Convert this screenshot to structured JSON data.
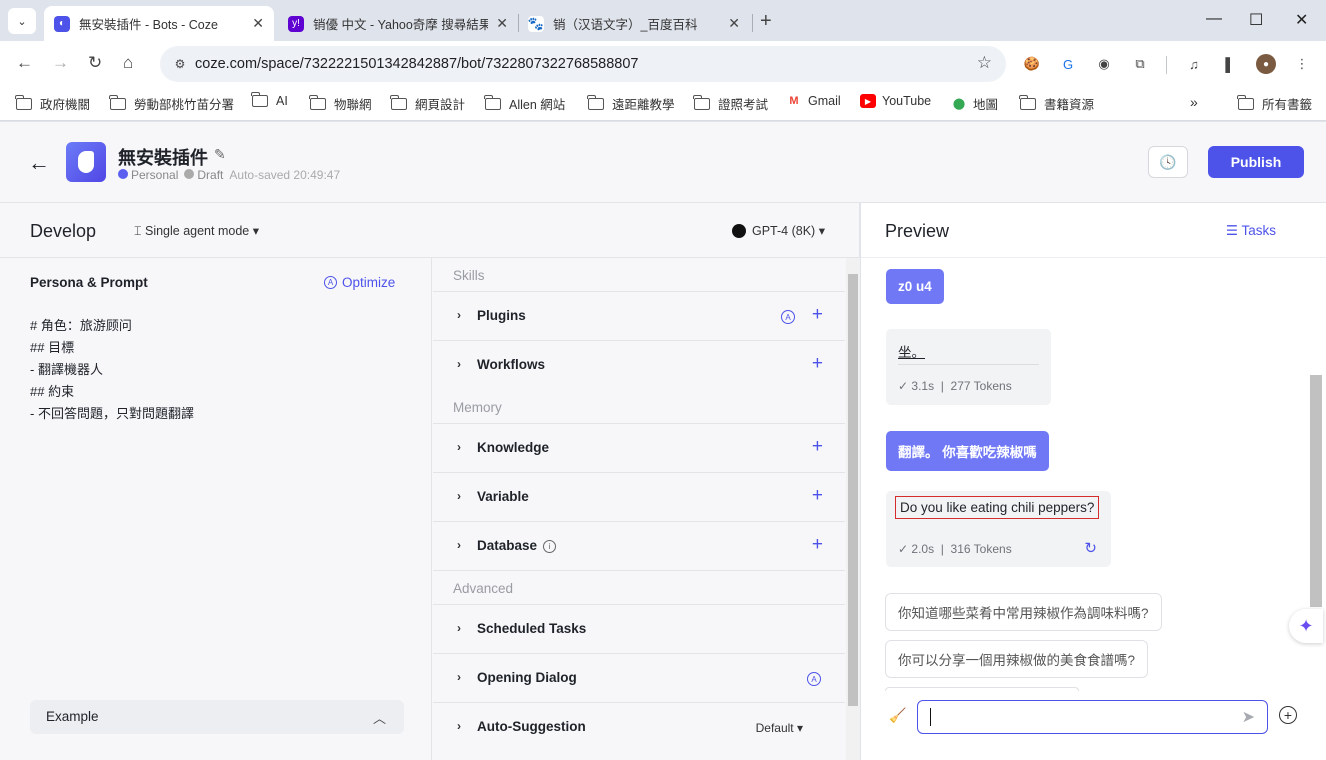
{
  "browser": {
    "tabs": [
      {
        "title": "無安裝插件 - Bots - Coze",
        "active": true,
        "favicon_color": "#4d53e8"
      },
      {
        "title": "销優 中文 - Yahoo奇摩 搜尋結果",
        "active": false,
        "favicon_color": "#5f01d1"
      },
      {
        "title": "销（汉语文字）_百度百科",
        "active": false,
        "favicon_color": "#2932e1"
      }
    ],
    "url": "coze.com/space/7322221501342842887/bot/7322807322768588807",
    "bookmarks": [
      {
        "label": "政府機關",
        "icon": "folder-icon"
      },
      {
        "label": "勞動部桃竹苗分署",
        "icon": "folder-icon"
      },
      {
        "label": "AI",
        "icon": "folder-icon"
      },
      {
        "label": "物聯網",
        "icon": "folder-icon"
      },
      {
        "label": "網頁設計",
        "icon": "folder-icon"
      },
      {
        "label": "Allen 網站",
        "icon": "folder-icon"
      },
      {
        "label": "遠距離教學",
        "icon": "folder-icon"
      },
      {
        "label": "證照考試",
        "icon": "folder-icon"
      },
      {
        "label": "Gmail",
        "icon": "gmail-icon"
      },
      {
        "label": "YouTube",
        "icon": "youtube-icon"
      },
      {
        "label": "地圖",
        "icon": "maps-icon"
      },
      {
        "label": "書籍資源",
        "icon": "folder-icon"
      }
    ],
    "all_bookmarks": "所有書籤"
  },
  "header": {
    "bot_name": "無安裝插件",
    "space": "Personal",
    "status": "Draft",
    "autosave": "Auto-saved 20:49:47",
    "publish_label": "Publish"
  },
  "develop": {
    "title": "Develop",
    "mode": "Single agent mode",
    "model": "GPT-4 (8K)",
    "persona": {
      "title": "Persona & Prompt",
      "optimize_label": "Optimize",
      "lines": [
        "# 角色：旅游顾问",
        "## 目標",
        "- 翻譯機器人",
        "## 約束",
        "- 不回答問題，只對問題翻譯"
      ],
      "example_label": "Example"
    },
    "skills_section": "Skills",
    "memory_section": "Memory",
    "advanced_section": "Advanced",
    "skills": {
      "plugins": "Plugins",
      "workflows": "Workflows",
      "knowledge": "Knowledge",
      "variable": "Variable",
      "database": "Database",
      "scheduled_tasks": "Scheduled Tasks",
      "opening_dialog": "Opening Dialog",
      "auto_suggestion": "Auto-Suggestion",
      "auto_suggestion_value": "Default"
    }
  },
  "preview": {
    "title": "Preview",
    "tasks_label": "Tasks",
    "messages": [
      {
        "role": "user",
        "text": "z0 u4"
      },
      {
        "role": "bot",
        "text": "坐。",
        "time": "3.1s",
        "tokens": "277 Tokens"
      },
      {
        "role": "user",
        "text": "翻譯。 你喜歡吃辣椒嗎"
      },
      {
        "role": "bot",
        "text": "Do you like eating chili peppers?",
        "time": "2.0s",
        "tokens": "316 Tokens"
      }
    ],
    "suggestions": [
      "你知道哪些菜肴中常用辣椒作為調味料嗎?",
      "你可以分享一個用辣椒做的美食食譜嗎?"
    ],
    "input_value": ""
  },
  "colors": {
    "accent": "#4d53e8",
    "user_bubble": "#7078f5",
    "highlight_box": "#d62b2b"
  }
}
